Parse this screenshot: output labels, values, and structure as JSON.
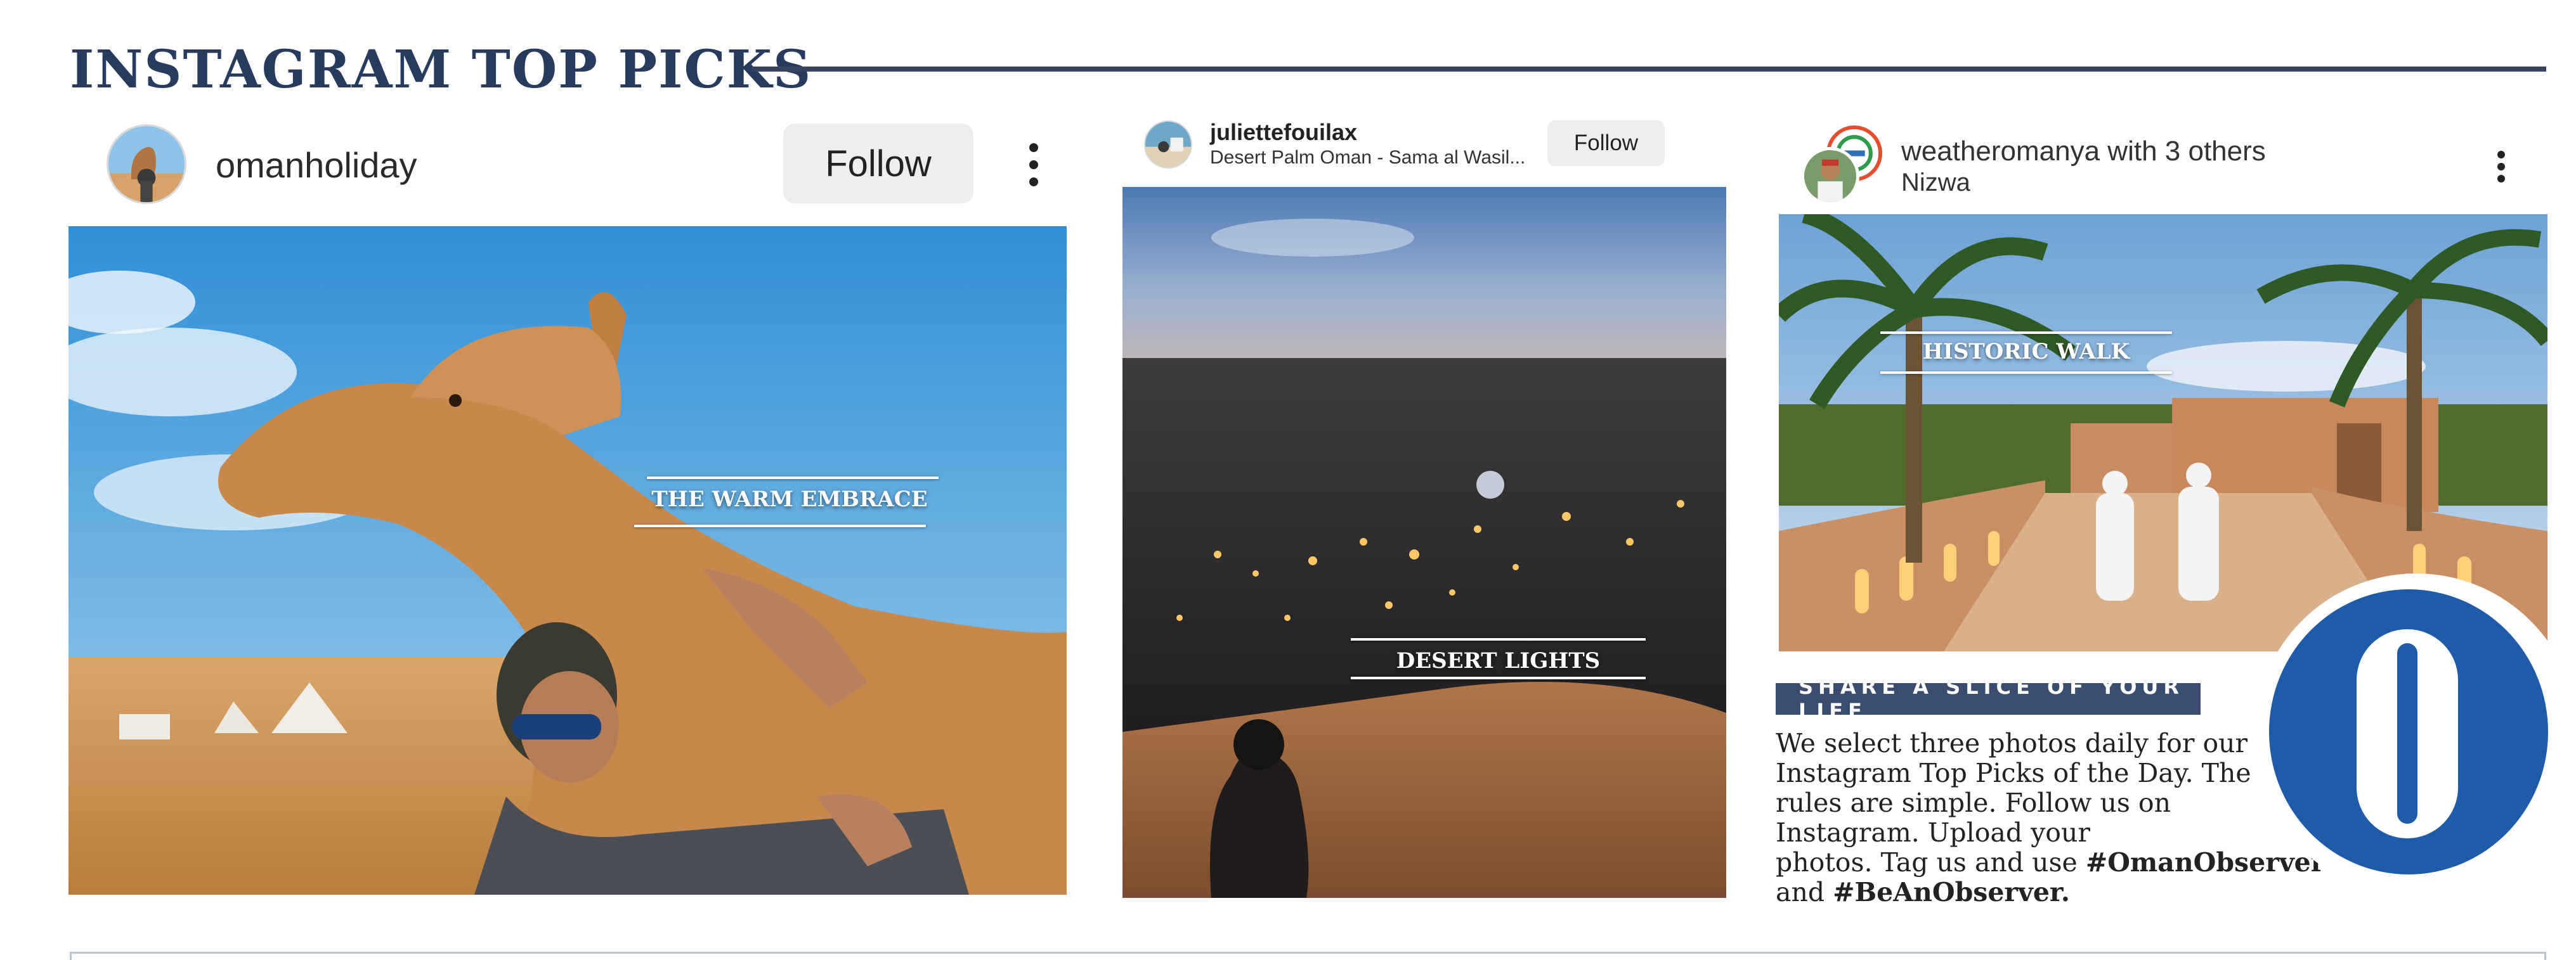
{
  "section": {
    "title": "INSTAGRAM TOP PICKS"
  },
  "posts": [
    {
      "username": "omanholiday",
      "follow_label": "Follow",
      "caption": "THE WARM EMBRACE",
      "avatar_icon": "camel-avatar",
      "photo": "man hugging a camel in the desert"
    },
    {
      "username": "juliettefouilax",
      "location": "Desert Palm Oman - Sama al Wasil...",
      "follow_label": "Follow",
      "caption": "DESERT LIGHTS",
      "avatar_icon": "beach-avatar",
      "photo": "desert camp at night from a dune"
    },
    {
      "username": "weatheromanya",
      "collab_text": " with ",
      "collab_count": "3 others",
      "location": "Nizwa",
      "caption": "HISTORIC WALK",
      "avatar_icon": "weather-logo-avatar",
      "photo": "two men walking toward a fort between palms"
    }
  ],
  "info": {
    "banner": "SHARE A SLICE OF YOUR LIFE",
    "lines": [
      "We select three photos daily for our",
      "Instagram Top Picks of the Day. The",
      "rules are simple. Follow us on",
      "Instagram. Upload your"
    ],
    "line5_prefix": "photos. Tag us and use ",
    "hashtag1": "#OmanObserver",
    "line6_prefix": "and ",
    "hashtag2": "#BeAnObserver."
  },
  "colors": {
    "navy": "#263b5e",
    "brand_blue": "#1e5ba8",
    "banner": "#3a4d6e"
  }
}
